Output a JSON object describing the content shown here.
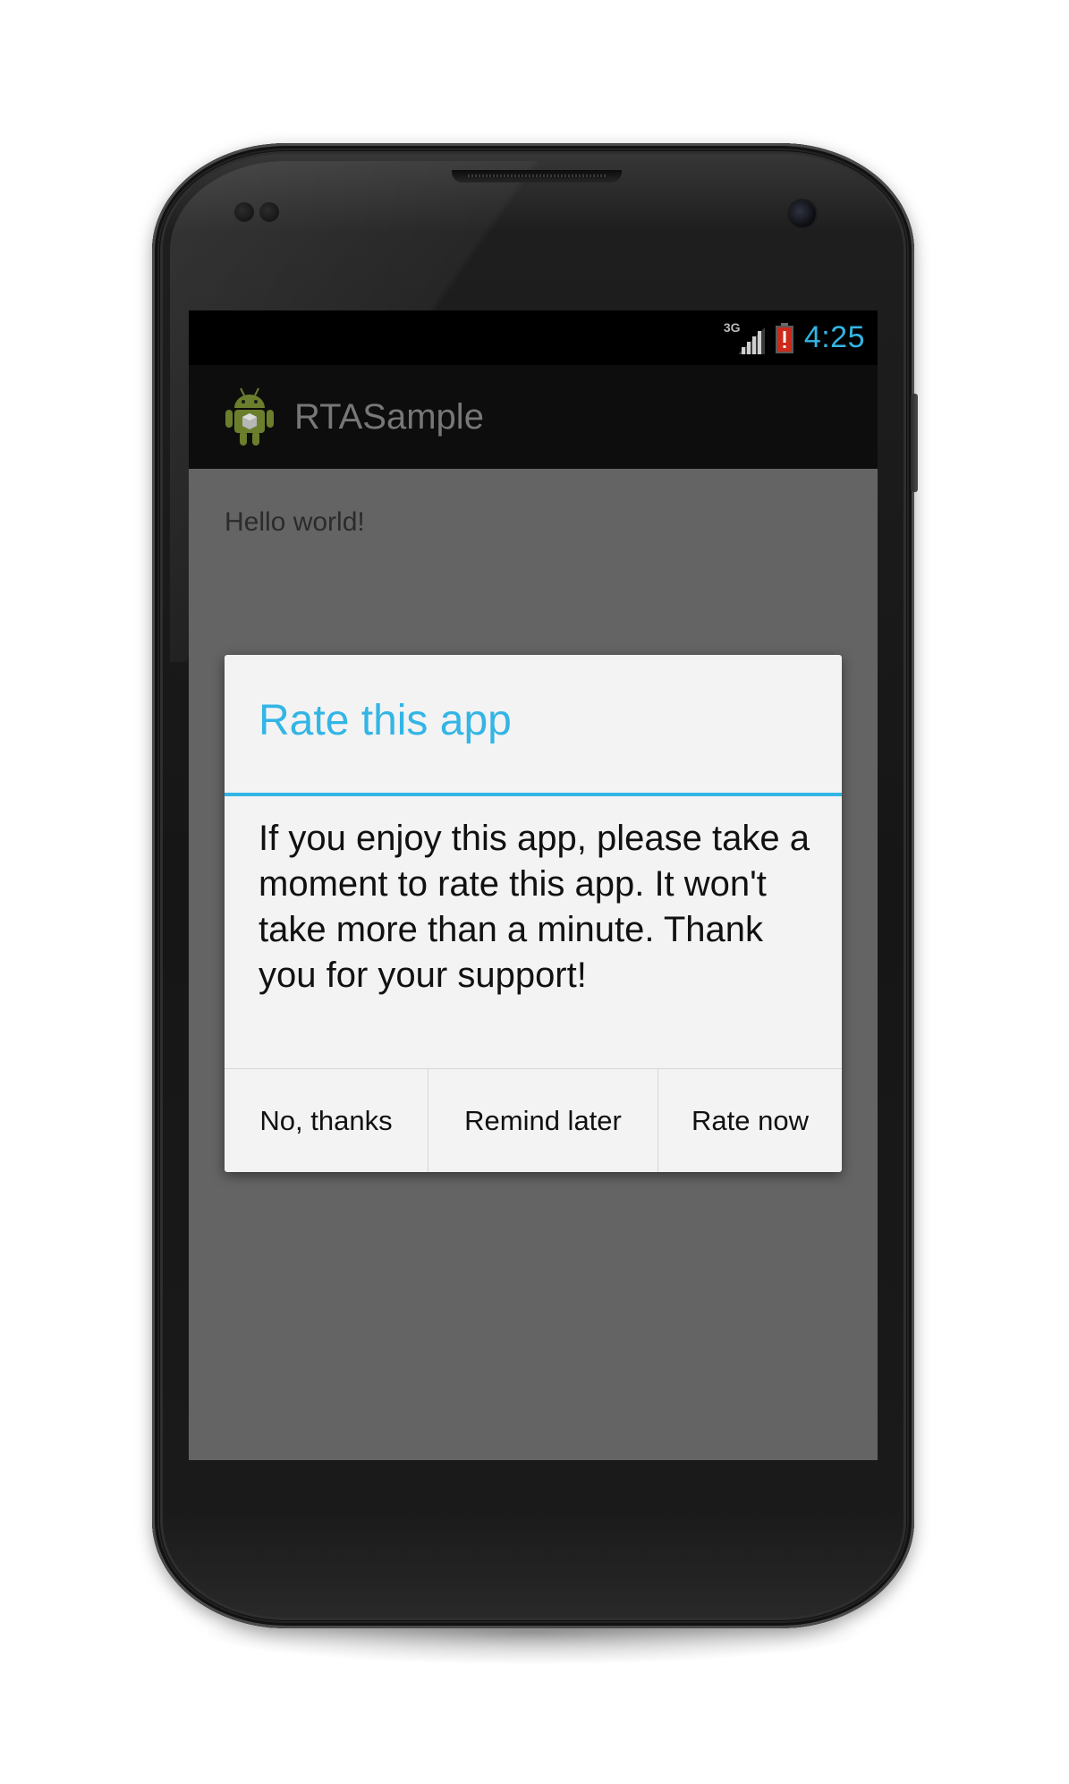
{
  "status_bar": {
    "network_type": "3G",
    "time": "4:25",
    "signal_icon": "cell-signal-icon",
    "battery_icon": "battery-alert-icon"
  },
  "action_bar": {
    "app_icon": "android-icon",
    "title": "RTASample"
  },
  "content": {
    "text": "Hello world!"
  },
  "dialog": {
    "title": "Rate this app",
    "message": "If you enjoy this app, please take a moment to rate this app. It won't take more than a minute. Thank you for your support!",
    "buttons": {
      "no_thanks": "No, thanks",
      "remind_later": "Remind later",
      "rate_now": "Rate now"
    }
  },
  "colors": {
    "accent": "#33b5e5",
    "screen_dim": "#646464",
    "dialog_bg": "#f3f3f3",
    "battery_alert": "#cc2a1a"
  }
}
